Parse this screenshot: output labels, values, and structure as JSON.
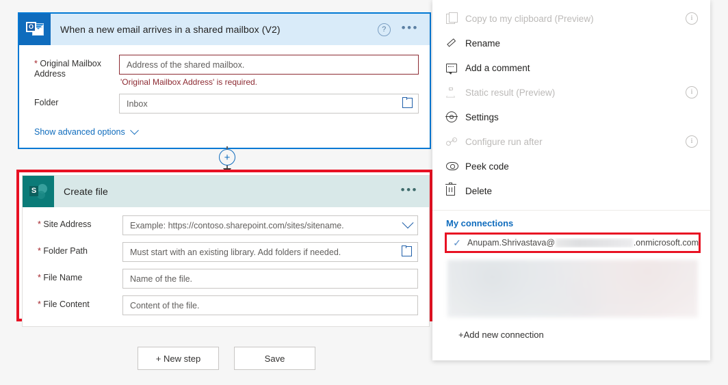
{
  "trigger": {
    "icon": "outlook-icon",
    "icon_letter": "O",
    "title": "When a new email arrives in a shared mailbox (V2)",
    "help_icon": "?",
    "more_icon": "•••",
    "fields": [
      {
        "label": "Original Mailbox Address",
        "required": true,
        "placeholder": "Address of the shared mailbox.",
        "value": "",
        "error": "'Original Mailbox Address' is required.",
        "trailing_icon": ""
      },
      {
        "label": "Folder",
        "required": false,
        "placeholder": "Inbox",
        "value": "Inbox",
        "error": "",
        "trailing_icon": "folder-picker-icon"
      }
    ],
    "advanced_link": "Show advanced options"
  },
  "connector": {
    "add_step_icon": "+"
  },
  "action": {
    "icon": "sharepoint-icon",
    "icon_letter": "S",
    "title": "Create file",
    "more_icon": "•••",
    "fields": [
      {
        "label": "Site Address",
        "required": true,
        "placeholder": "Example: https://contoso.sharepoint.com/sites/sitename.",
        "value": "",
        "trailing_icon": "chevron-down-icon"
      },
      {
        "label": "Folder Path",
        "required": true,
        "placeholder": "Must start with an existing library. Add folders if needed.",
        "value": "",
        "trailing_icon": "folder-picker-icon"
      },
      {
        "label": "File Name",
        "required": true,
        "placeholder": "Name of the file.",
        "value": "",
        "trailing_icon": ""
      },
      {
        "label": "File Content",
        "required": true,
        "placeholder": "Content of the file.",
        "value": "",
        "trailing_icon": ""
      }
    ]
  },
  "footer": {
    "new_step_label": "+ New step",
    "save_label": "Save"
  },
  "panel": {
    "menu": [
      {
        "label": "Copy to my clipboard (Preview)",
        "icon": "copy-icon",
        "disabled": true,
        "info": true
      },
      {
        "label": "Rename",
        "icon": "pencil-icon",
        "disabled": false,
        "info": false
      },
      {
        "label": "Add a comment",
        "icon": "comment-icon",
        "disabled": false,
        "info": false
      },
      {
        "label": "Static result (Preview)",
        "icon": "flask-icon",
        "disabled": true,
        "info": true
      },
      {
        "label": "Settings",
        "icon": "gear-icon",
        "disabled": false,
        "info": false
      },
      {
        "label": "Configure run after",
        "icon": "run-after-icon",
        "disabled": true,
        "info": true
      },
      {
        "label": "Peek code",
        "icon": "eye-icon",
        "disabled": false,
        "info": false
      },
      {
        "label": "Delete",
        "icon": "trash-icon",
        "disabled": false,
        "info": false
      }
    ],
    "connections": {
      "title": "My connections",
      "selected": {
        "check_icon": "checkmark-icon",
        "email_prefix": "Anupam.Shrivastava@",
        "email_redacted": true,
        "email_suffix": ".onmicrosoft.com"
      },
      "add_new_label": "+Add new connection"
    }
  },
  "colors": {
    "trigger_border": "#0078d4",
    "trigger_header_bg": "#d9ebf9",
    "action_header_bg": "#d8e8e8",
    "highlight_red": "#e81123",
    "error_red": "#8c2a32",
    "link_blue": "#0f6cbd",
    "outlook_blue": "#0f6cbd",
    "sharepoint_teal": "#0b7b78"
  }
}
